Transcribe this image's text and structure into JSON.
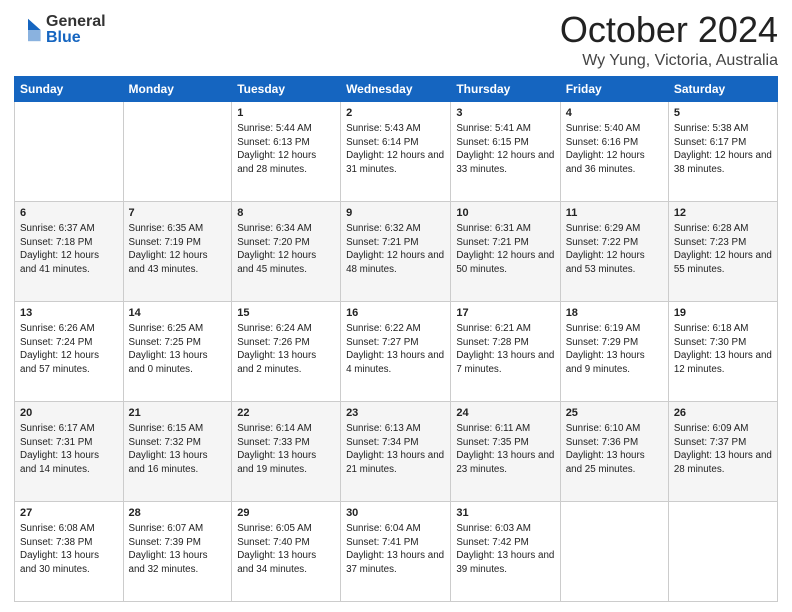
{
  "header": {
    "logo_general": "General",
    "logo_blue": "Blue",
    "month_title": "October 2024",
    "location": "Wy Yung, Victoria, Australia"
  },
  "weekdays": [
    "Sunday",
    "Monday",
    "Tuesday",
    "Wednesday",
    "Thursday",
    "Friday",
    "Saturday"
  ],
  "weeks": [
    [
      {
        "day": "",
        "info": ""
      },
      {
        "day": "",
        "info": ""
      },
      {
        "day": "1",
        "info": "Sunrise: 5:44 AM\nSunset: 6:13 PM\nDaylight: 12 hours\nand 28 minutes."
      },
      {
        "day": "2",
        "info": "Sunrise: 5:43 AM\nSunset: 6:14 PM\nDaylight: 12 hours\nand 31 minutes."
      },
      {
        "day": "3",
        "info": "Sunrise: 5:41 AM\nSunset: 6:15 PM\nDaylight: 12 hours\nand 33 minutes."
      },
      {
        "day": "4",
        "info": "Sunrise: 5:40 AM\nSunset: 6:16 PM\nDaylight: 12 hours\nand 36 minutes."
      },
      {
        "day": "5",
        "info": "Sunrise: 5:38 AM\nSunset: 6:17 PM\nDaylight: 12 hours\nand 38 minutes."
      }
    ],
    [
      {
        "day": "6",
        "info": "Sunrise: 6:37 AM\nSunset: 7:18 PM\nDaylight: 12 hours\nand 41 minutes."
      },
      {
        "day": "7",
        "info": "Sunrise: 6:35 AM\nSunset: 7:19 PM\nDaylight: 12 hours\nand 43 minutes."
      },
      {
        "day": "8",
        "info": "Sunrise: 6:34 AM\nSunset: 7:20 PM\nDaylight: 12 hours\nand 45 minutes."
      },
      {
        "day": "9",
        "info": "Sunrise: 6:32 AM\nSunset: 7:21 PM\nDaylight: 12 hours\nand 48 minutes."
      },
      {
        "day": "10",
        "info": "Sunrise: 6:31 AM\nSunset: 7:21 PM\nDaylight: 12 hours\nand 50 minutes."
      },
      {
        "day": "11",
        "info": "Sunrise: 6:29 AM\nSunset: 7:22 PM\nDaylight: 12 hours\nand 53 minutes."
      },
      {
        "day": "12",
        "info": "Sunrise: 6:28 AM\nSunset: 7:23 PM\nDaylight: 12 hours\nand 55 minutes."
      }
    ],
    [
      {
        "day": "13",
        "info": "Sunrise: 6:26 AM\nSunset: 7:24 PM\nDaylight: 12 hours\nand 57 minutes."
      },
      {
        "day": "14",
        "info": "Sunrise: 6:25 AM\nSunset: 7:25 PM\nDaylight: 13 hours\nand 0 minutes."
      },
      {
        "day": "15",
        "info": "Sunrise: 6:24 AM\nSunset: 7:26 PM\nDaylight: 13 hours\nand 2 minutes."
      },
      {
        "day": "16",
        "info": "Sunrise: 6:22 AM\nSunset: 7:27 PM\nDaylight: 13 hours\nand 4 minutes."
      },
      {
        "day": "17",
        "info": "Sunrise: 6:21 AM\nSunset: 7:28 PM\nDaylight: 13 hours\nand 7 minutes."
      },
      {
        "day": "18",
        "info": "Sunrise: 6:19 AM\nSunset: 7:29 PM\nDaylight: 13 hours\nand 9 minutes."
      },
      {
        "day": "19",
        "info": "Sunrise: 6:18 AM\nSunset: 7:30 PM\nDaylight: 13 hours\nand 12 minutes."
      }
    ],
    [
      {
        "day": "20",
        "info": "Sunrise: 6:17 AM\nSunset: 7:31 PM\nDaylight: 13 hours\nand 14 minutes."
      },
      {
        "day": "21",
        "info": "Sunrise: 6:15 AM\nSunset: 7:32 PM\nDaylight: 13 hours\nand 16 minutes."
      },
      {
        "day": "22",
        "info": "Sunrise: 6:14 AM\nSunset: 7:33 PM\nDaylight: 13 hours\nand 19 minutes."
      },
      {
        "day": "23",
        "info": "Sunrise: 6:13 AM\nSunset: 7:34 PM\nDaylight: 13 hours\nand 21 minutes."
      },
      {
        "day": "24",
        "info": "Sunrise: 6:11 AM\nSunset: 7:35 PM\nDaylight: 13 hours\nand 23 minutes."
      },
      {
        "day": "25",
        "info": "Sunrise: 6:10 AM\nSunset: 7:36 PM\nDaylight: 13 hours\nand 25 minutes."
      },
      {
        "day": "26",
        "info": "Sunrise: 6:09 AM\nSunset: 7:37 PM\nDaylight: 13 hours\nand 28 minutes."
      }
    ],
    [
      {
        "day": "27",
        "info": "Sunrise: 6:08 AM\nSunset: 7:38 PM\nDaylight: 13 hours\nand 30 minutes."
      },
      {
        "day": "28",
        "info": "Sunrise: 6:07 AM\nSunset: 7:39 PM\nDaylight: 13 hours\nand 32 minutes."
      },
      {
        "day": "29",
        "info": "Sunrise: 6:05 AM\nSunset: 7:40 PM\nDaylight: 13 hours\nand 34 minutes."
      },
      {
        "day": "30",
        "info": "Sunrise: 6:04 AM\nSunset: 7:41 PM\nDaylight: 13 hours\nand 37 minutes."
      },
      {
        "day": "31",
        "info": "Sunrise: 6:03 AM\nSunset: 7:42 PM\nDaylight: 13 hours\nand 39 minutes."
      },
      {
        "day": "",
        "info": ""
      },
      {
        "day": "",
        "info": ""
      }
    ]
  ]
}
